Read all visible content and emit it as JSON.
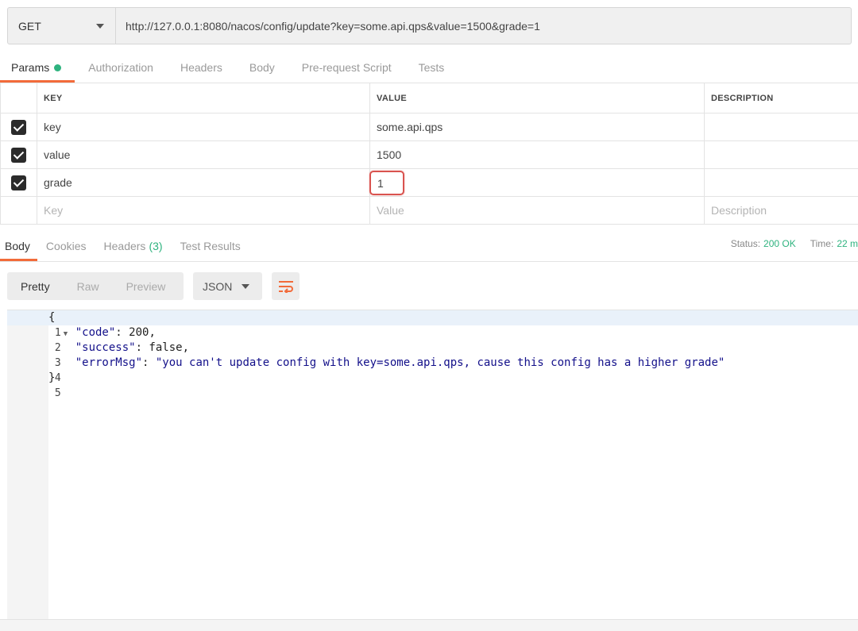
{
  "request": {
    "method": "GET",
    "url": "http://127.0.0.1:8080/nacos/config/update?key=some.api.qps&value=1500&grade=1"
  },
  "request_tabs": [
    {
      "label": "Params",
      "active": true
    },
    {
      "label": "Authorization"
    },
    {
      "label": "Headers"
    },
    {
      "label": "Body"
    },
    {
      "label": "Pre-request Script"
    },
    {
      "label": "Tests"
    }
  ],
  "params": {
    "headers": {
      "key": "KEY",
      "value": "VALUE",
      "description": "DESCRIPTION"
    },
    "rows": [
      {
        "checked": true,
        "key": "key",
        "value": "some.api.qps",
        "description": ""
      },
      {
        "checked": true,
        "key": "value",
        "value": "1500",
        "description": ""
      },
      {
        "checked": true,
        "key": "grade",
        "value": "1",
        "description": ""
      }
    ],
    "placeholders": {
      "key": "Key",
      "value": "Value",
      "description": "Description"
    }
  },
  "response_tabs": [
    {
      "label": "Body",
      "active": true
    },
    {
      "label": "Cookies"
    },
    {
      "label": "Headers",
      "count": "(3)"
    },
    {
      "label": "Test Results"
    }
  ],
  "status": {
    "status_label": "Status:",
    "status_value": "200 OK",
    "time_label": "Time:",
    "time_value": "22 m"
  },
  "viewer": {
    "modes": [
      "Pretty",
      "Raw",
      "Preview"
    ],
    "format": "JSON"
  },
  "code_lines": [
    {
      "n": "1",
      "text": "{"
    },
    {
      "n": "2",
      "key": "\"code\"",
      "rest": ": 200,"
    },
    {
      "n": "3",
      "key": "\"success\"",
      "rest": ": false,"
    },
    {
      "n": "4",
      "key": "\"errorMsg\"",
      "rest": ": ",
      "str": "\"you can't update config with key=some.api.qps, cause this config has a higher grade\""
    },
    {
      "n": "5",
      "text": "}"
    }
  ],
  "colors": {
    "accent": "#f26b3a",
    "status_ok": "#2fb37f",
    "highlight_box": "#d9534f"
  }
}
